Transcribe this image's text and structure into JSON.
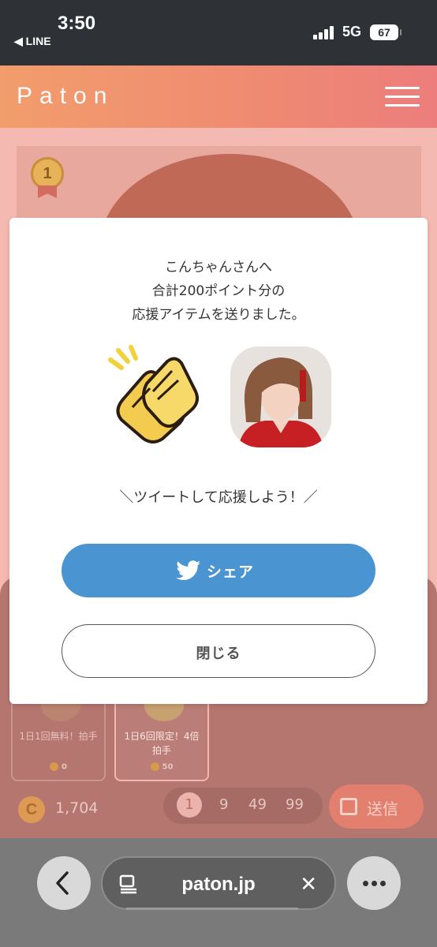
{
  "status_bar": {
    "time": "3:50",
    "back_app": "◀ LINE",
    "network": "5G",
    "battery": "67"
  },
  "header": {
    "logo": "Paton",
    "menu_icon": "hamburger-icon"
  },
  "background": {
    "rank": "1",
    "items": [
      {
        "name": "1日1回無料！拍手",
        "cost": "0"
      },
      {
        "name": "1日6回限定！4倍拍手",
        "cost": "50"
      }
    ],
    "balance": "1,704",
    "coin_symbol": "C",
    "multipliers": [
      "1",
      "9",
      "49",
      "99"
    ],
    "send_label": "送信"
  },
  "modal": {
    "message_lines": [
      "こんちゃんさんへ",
      "合計200ポイント分の",
      "応援アイテムを送りました。"
    ],
    "cta": "＼ツイートして応援しよう！／",
    "share_label": "シェア",
    "close_label": "閉じる",
    "share_color": "#4a94d1"
  },
  "browser": {
    "url": "paton.jp"
  }
}
